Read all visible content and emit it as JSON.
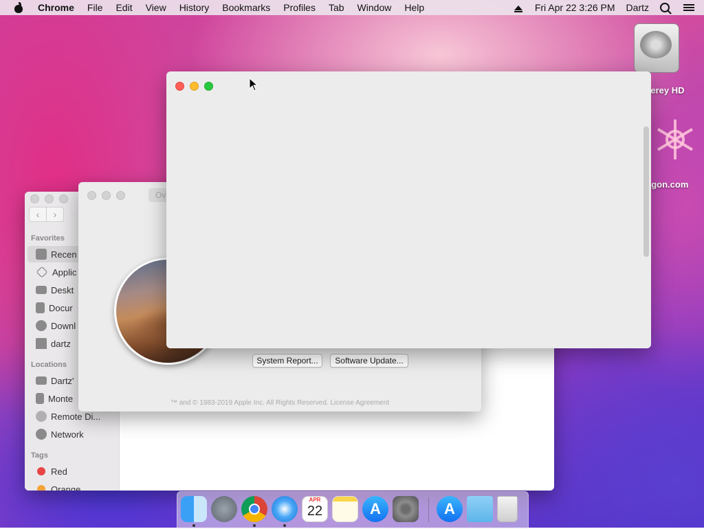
{
  "menubar": {
    "app_name": "Chrome",
    "items": [
      "File",
      "Edit",
      "View",
      "History",
      "Bookmarks",
      "Profiles",
      "Tab",
      "Window",
      "Help"
    ],
    "datetime": "Fri Apr 22  3:26 PM",
    "user": "Dartz"
  },
  "desktop": {
    "icons": [
      {
        "label": "terey HD",
        "icon": "hard-drive-icon"
      },
      {
        "label": "agon.com",
        "icon": "snowflake-app-icon"
      }
    ]
  },
  "finder": {
    "sections": {
      "favorites": "Favorites",
      "locations": "Locations",
      "tags": "Tags"
    },
    "favorites": [
      "Recen",
      "Applic",
      "Deskt",
      "Docur",
      "Downl",
      "dartz"
    ],
    "locations": [
      "Dartz'",
      "Monte",
      "Remote Di...",
      "Network"
    ],
    "tags": [
      "Red",
      "Orange"
    ]
  },
  "about_mac": {
    "tab_stub": "Ov",
    "buttons": {
      "system_report": "System Report...",
      "software_update": "Software Update..."
    },
    "legal": "™ and © 1983-2019 Apple Inc. All Rights Reserved. License Agreement"
  },
  "dock": {
    "calendar_month": "APR",
    "calendar_day": "22",
    "apps": [
      "finder-icon",
      "launchpad-icon",
      "chrome-icon",
      "safari-icon",
      "calendar-icon",
      "notes-icon",
      "app-store-icon",
      "system-preferences-icon",
      "app-store-icon",
      "downloads-folder-icon",
      "trash-icon"
    ]
  }
}
